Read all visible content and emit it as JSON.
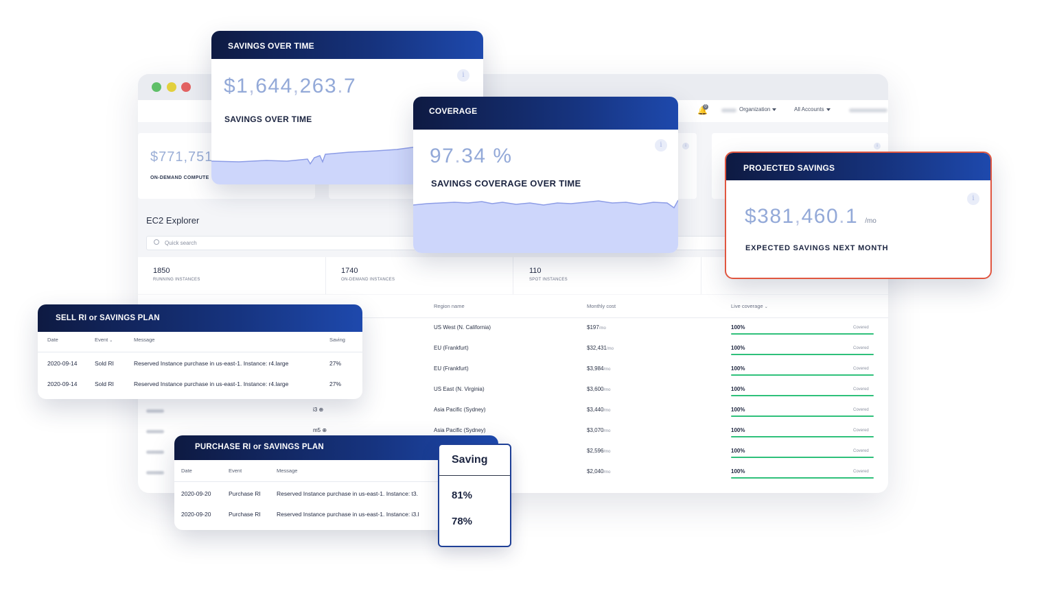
{
  "window": {
    "nav": {
      "org_label": "Organization",
      "accounts_label": "All Accounts",
      "notif_count": "0"
    },
    "kpi": {
      "value": "$771,751",
      "label": "ON-DEMAND COMPUTE"
    },
    "explorer_title": "EC2 Explorer",
    "search_placeholder": "Quick search",
    "stats": [
      {
        "value": "1850",
        "label": "RUNNING INSTANCES"
      },
      {
        "value": "1740",
        "label": "ON-DEMAND INSTANCES"
      },
      {
        "value": "110",
        "label": "SPOT INSTANCES"
      }
    ],
    "table": {
      "headers": {
        "region": "Region name",
        "cost": "Monthly cost",
        "coverage": "Live coverage"
      },
      "rows": [
        {
          "type": "",
          "region": "US West (N. California)",
          "cost": "$197",
          "unit": "/mo",
          "coverage": "100%",
          "status": "Covered"
        },
        {
          "type": "",
          "region": "EU (Frankfurt)",
          "cost": "$32,431",
          "unit": "/mo",
          "coverage": "100%",
          "status": "Covered"
        },
        {
          "type": "",
          "region": "EU (Frankfurt)",
          "cost": "$3,984",
          "unit": "/mo",
          "coverage": "100%",
          "status": "Covered"
        },
        {
          "type": "",
          "region": "US East (N. Virginia)",
          "cost": "$3,600",
          "unit": "/mo",
          "coverage": "100%",
          "status": "Covered"
        },
        {
          "type": "i3 ⊕",
          "region": "Asia Pacific (Sydney)",
          "cost": "$3,440",
          "unit": "/mo",
          "coverage": "100%",
          "status": "Covered"
        },
        {
          "type": "m5 ⊕",
          "region": "Asia Pacific (Sydney)",
          "cost": "$3,070",
          "unit": "/mo",
          "coverage": "100%",
          "status": "Covered"
        },
        {
          "type": "",
          "region": "",
          "cost": "$2,596",
          "unit": "/mo",
          "coverage": "100%",
          "status": "Covered"
        },
        {
          "type": "",
          "region": "",
          "cost": "$2,040",
          "unit": "/mo",
          "coverage": "100%",
          "status": "Covered"
        }
      ]
    }
  },
  "savings_card": {
    "title": "SAVINGS OVER TIME",
    "value_parts": [
      "$1",
      ",",
      "644",
      ",",
      "263",
      ".",
      "7"
    ],
    "label": "SAVINGS OVER TIME",
    "info": "i"
  },
  "coverage_card": {
    "title": "COVERAGE",
    "value_parts": [
      "97",
      ".",
      "34",
      " %"
    ],
    "label": "SAVINGS COVERAGE OVER TIME",
    "info": "i"
  },
  "projected_card": {
    "title": "PROJECTED SAVINGS",
    "value_parts": [
      "$381",
      ",",
      "460",
      ".",
      "1"
    ],
    "unit": "/mo",
    "label": "EXPECTED SAVINGS NEXT MONTH",
    "info": "i",
    "border_color": "#e0553f"
  },
  "sell_card": {
    "title": "SELL RI or SAVINGS PLAN",
    "headers": {
      "date": "Date",
      "event": "Event",
      "message": "Message",
      "saving": "Saving"
    },
    "rows": [
      {
        "date": "2020-09-14",
        "event": "Sold RI",
        "message": "Reserved Instance purchase in us-east-1. Instance: r4.large",
        "saving": "27%"
      },
      {
        "date": "2020-09-14",
        "event": "Sold RI",
        "message": "Reserved Instance purchase in us-east-1. Instance: r4.large",
        "saving": "27%"
      }
    ]
  },
  "purchase_card": {
    "title": "PURCHASE RI or SAVINGS PLAN",
    "headers": {
      "date": "Date",
      "event": "Event",
      "message": "Message"
    },
    "rows": [
      {
        "date": "2020-09-20",
        "event": "Purchase RI",
        "message": "Reserved Instance purchase in us-east-1. Instance: t3."
      },
      {
        "date": "2020-09-20",
        "event": "Purchase RI",
        "message": "Reserved Instance purchase in us-east-1. Instance: i3.l"
      }
    ]
  },
  "saving_popup": {
    "title": "Saving",
    "values": [
      "81%",
      "78%"
    ]
  },
  "colors": {
    "accent": "#1e49ad",
    "header_dark": "#0e1a42",
    "coverage_green": "#2ec07a",
    "area_fill": "#cdd6fb",
    "area_line": "#8c9ce6"
  }
}
